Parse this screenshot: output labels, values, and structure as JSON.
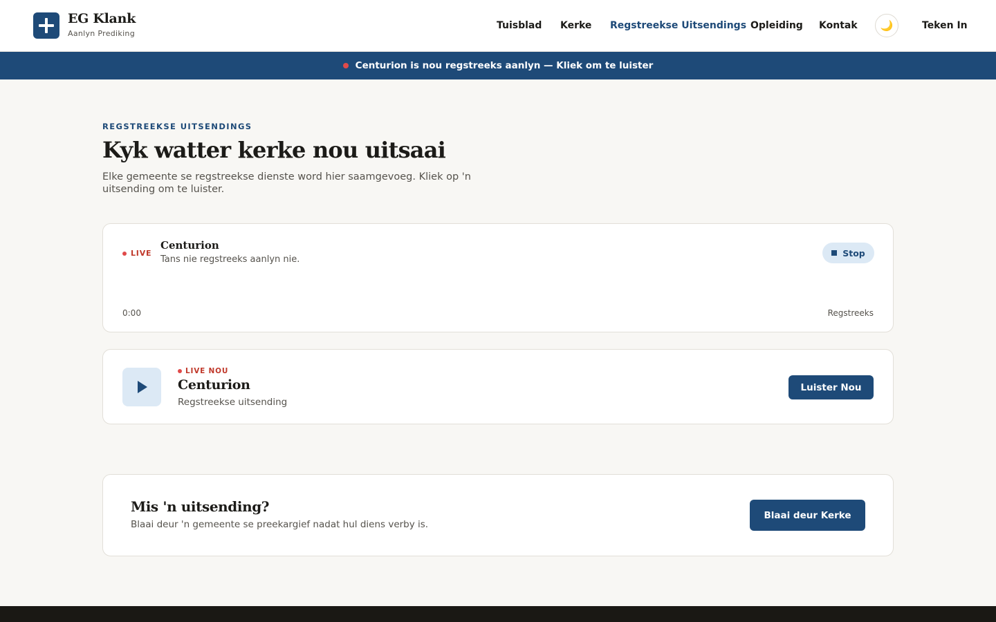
{
  "brand": {
    "name": "EG Klank",
    "tagline": "Aanlyn Prediking"
  },
  "nav": {
    "items": [
      "Tuisblad",
      "Kerke",
      "Regstreekse Uitsendings",
      "Opleiding",
      "Kontak"
    ],
    "active": "Regstreekse Uitsendings",
    "theme_icon": "moon-icon",
    "theme_glyph": "🌙",
    "sign_in": "Teken In"
  },
  "banner": {
    "text": "Centurion is nou regstreeks aanlyn — Kliek om te luister"
  },
  "hero": {
    "eyebrow": "REGSTREEKSE UITSENDINGS",
    "title": "Kyk watter kerke nou uitsaai",
    "lede": "Elke gemeente se regstreekse dienste word hier saamgevoeg. Kliek op 'n uitsending om te luister."
  },
  "player": {
    "live_label": "LIVE",
    "title": "Centurion",
    "status": "Tans nie regstreeks aanlyn nie.",
    "stop_label": "Stop",
    "time": "0:00",
    "mode": "Regstreeks"
  },
  "streams": [
    {
      "badge": "LIVE NOU",
      "title": "Centurion",
      "subtitle": "Regstreekse uitsending",
      "cta": "Luister Nou"
    }
  ],
  "archive": {
    "title": "Mis 'n uitsending?",
    "subtitle": "Blaai deur 'n gemeente se preekargief nadat hul diens verby is.",
    "cta": "Blaai deur Kerke"
  },
  "colors": {
    "primary": "#1e4a78",
    "live_red": "#e04a4a",
    "page_bg": "#f8f7f4",
    "footer_bg": "#1a1814"
  }
}
